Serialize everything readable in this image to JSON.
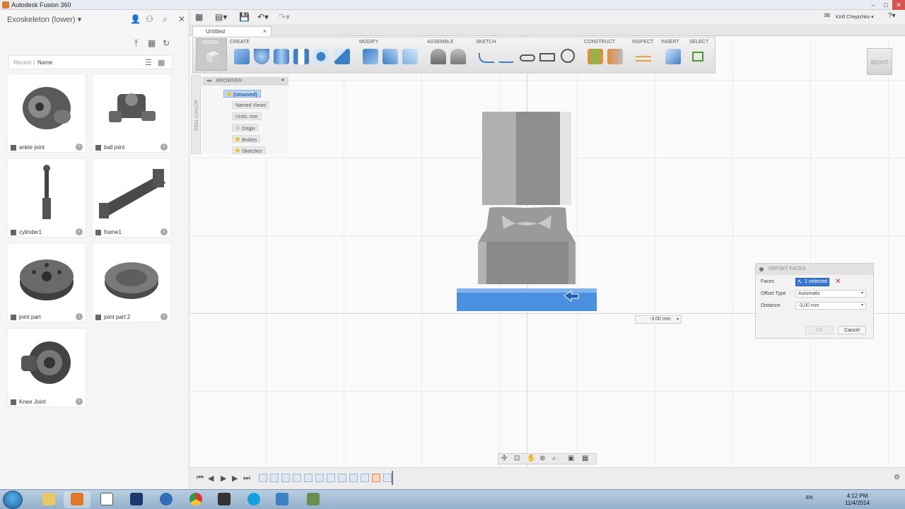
{
  "window": {
    "title": "Autodesk Fusion 360",
    "minimize": "–",
    "maximize": "□",
    "close": "✕"
  },
  "datapanel": {
    "project": "Exoskeleton (lower)",
    "recent_label": "Recent",
    "sort_label": "Name",
    "items": [
      {
        "name": "ankle joint"
      },
      {
        "name": "ball joint"
      },
      {
        "name": "cylinder1"
      },
      {
        "name": "frame1"
      },
      {
        "name": "joint part"
      },
      {
        "name": "joint part 2"
      },
      {
        "name": "Knee Joint"
      }
    ]
  },
  "appbar": {
    "user": "Kirill Chepizhko ▾",
    "help": "?"
  },
  "tab": {
    "label": "Untitled",
    "close": "×"
  },
  "ribbon": {
    "model_label": "MODEL",
    "groups": [
      "CREATE",
      "MODIFY",
      "ASSEMBLE",
      "SKETCH",
      "CONSTRUCT",
      "INSPECT",
      "INSERT",
      "SELECT"
    ]
  },
  "activity_feed": "ACTIVITY FEED",
  "browser": {
    "header": "BROWSER",
    "nodes": [
      "(Unsaved)",
      "Named Views",
      "Units: mm",
      "Origin",
      "Bodies",
      "Sketches"
    ]
  },
  "viewcube": {
    "face": "RIGHT"
  },
  "dialog": {
    "title": "OFFSET FACES",
    "faces_label": "Faces",
    "faces_value": "1 selected",
    "offset_type_label": "Offset Type",
    "offset_type_value": "Automatic",
    "distance_label": "Distance",
    "distance_value": "-3.00 mm",
    "ok": "OK",
    "cancel": "Cancel"
  },
  "distance_input": "-3.00 mm",
  "taskbar": {
    "lang": "EN",
    "time": "4:12 PM",
    "date": "11/4/2014"
  },
  "colors": {
    "selected_face": "#4a8fe0",
    "accent": "#3a78d4",
    "model_body": "#a9a9a9"
  }
}
